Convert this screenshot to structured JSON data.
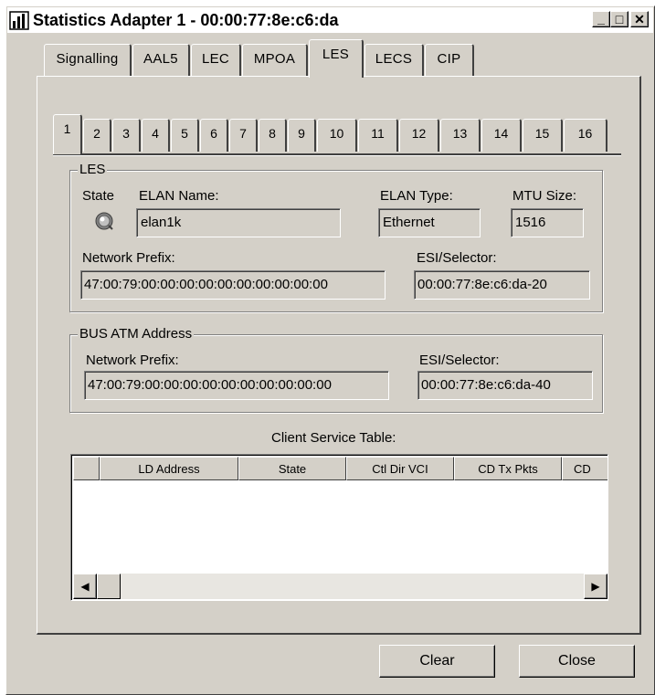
{
  "window": {
    "title": "Statistics Adapter 1 - 00:00:77:8e:c6:da",
    "minimize_glyph": "_",
    "maximize_glyph": "□",
    "close_glyph": "✕"
  },
  "outer_tabs": [
    {
      "label": "Signalling"
    },
    {
      "label": "AAL5"
    },
    {
      "label": "LEC"
    },
    {
      "label": "MPOA"
    },
    {
      "label": "LES",
      "active": true
    },
    {
      "label": "LECS"
    },
    {
      "label": "CIP"
    }
  ],
  "number_tabs": [
    "1",
    "2",
    "3",
    "4",
    "5",
    "6",
    "7",
    "8",
    "9",
    "10",
    "11",
    "12",
    "13",
    "14",
    "15",
    "16"
  ],
  "les": {
    "group_label": "LES",
    "state_label": "State",
    "elan_name_label": "ELAN Name:",
    "elan_name_value": "elan1k",
    "elan_type_label": "ELAN Type:",
    "elan_type_value": "Ethernet",
    "mtu_label": "MTU Size:",
    "mtu_value": "1516",
    "prefix_label": "Network Prefix:",
    "prefix_value": "47:00:79:00:00:00:00:00:00:00:00:00:00",
    "esi_label": "ESI/Selector:",
    "esi_value": "00:00:77:8e:c6:da-20"
  },
  "bus": {
    "group_label": "BUS ATM Address",
    "prefix_label": "Network Prefix:",
    "prefix_value": "47:00:79:00:00:00:00:00:00:00:00:00:00",
    "esi_label": "ESI/Selector:",
    "esi_value": "00:00:77:8e:c6:da-40"
  },
  "client_table": {
    "title": "Client Service Table:",
    "columns": [
      "",
      "LD Address",
      "State",
      "Ctl Dir VCI",
      "CD Tx Pkts",
      "CD"
    ],
    "rows": []
  },
  "buttons": {
    "clear": "Clear",
    "close": "Close"
  },
  "colors": {
    "face": "#d4d0c8",
    "shadow": "#808080",
    "highlight": "#ffffff"
  }
}
